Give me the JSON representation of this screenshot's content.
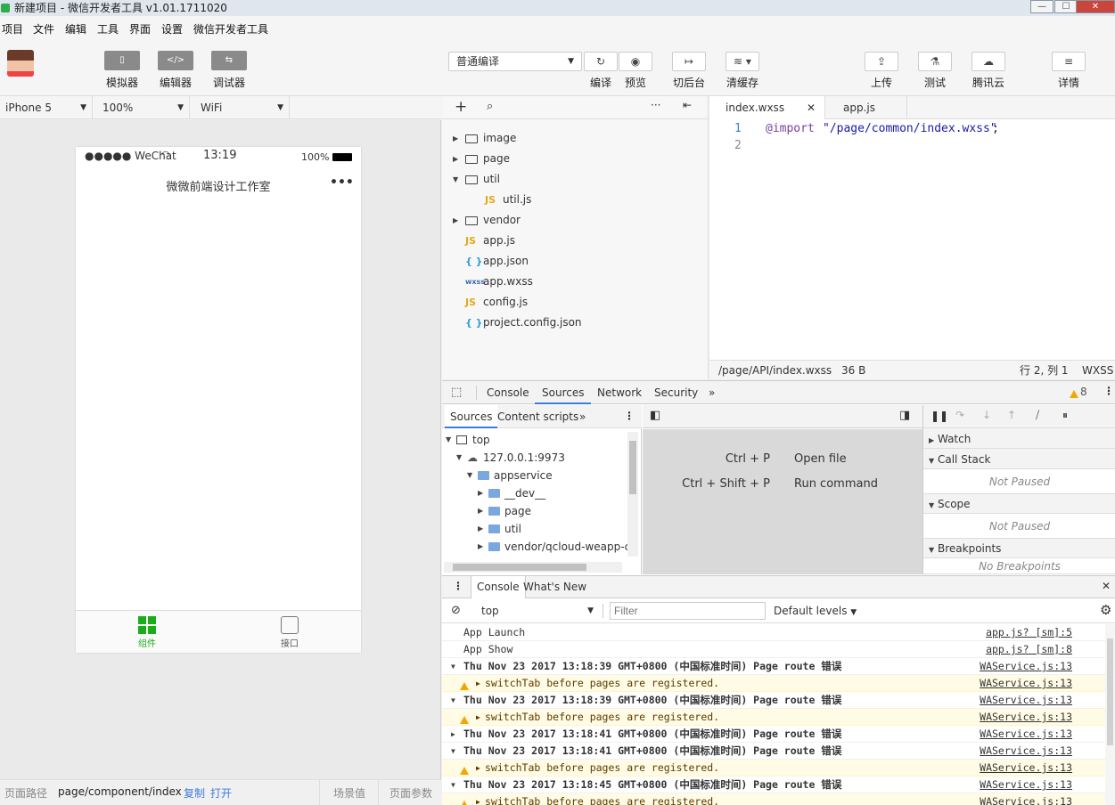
{
  "window": {
    "title": "新建项目 - 微信开发者工具 v1.01.1711020",
    "min": "—",
    "max": "☐",
    "close": "✕"
  },
  "menu": [
    "项目",
    "文件",
    "编辑",
    "工具",
    "界面",
    "设置",
    "微信开发者工具"
  ],
  "toolbar": {
    "left": [
      {
        "label": "模拟器",
        "icon": "phone-icon",
        "glyph": "▯"
      },
      {
        "label": "编辑器",
        "icon": "code-icon",
        "glyph": "</>"
      },
      {
        "label": "调试器",
        "icon": "debug-icon",
        "glyph": "⇆"
      }
    ],
    "compile_mode": "普通编译",
    "mid": [
      {
        "label": "编译",
        "icon": "refresh-icon",
        "glyph": "↻"
      },
      {
        "label": "预览",
        "icon": "eye-icon",
        "glyph": "◉"
      },
      {
        "label": "切后台",
        "icon": "switch-bg-icon",
        "glyph": "↦"
      },
      {
        "label": "清缓存",
        "icon": "layers-icon",
        "glyph": "≋"
      }
    ],
    "right": [
      {
        "label": "上传",
        "icon": "upload-icon",
        "glyph": "⇪"
      },
      {
        "label": "测试",
        "icon": "flask-icon",
        "glyph": "⚗"
      },
      {
        "label": "腾讯云",
        "icon": "cloud-icon",
        "glyph": "☁"
      },
      {
        "label": "详情",
        "icon": "menu-icon",
        "glyph": "≡"
      }
    ]
  },
  "simulator": {
    "device": "iPhone 5",
    "zoom": "100%",
    "network": "WiFi",
    "status_left": "●●●●● WeChat",
    "time": "13:19",
    "battery": "100%",
    "nav_title": "微微前端设计工作室",
    "nav_more": "•••",
    "tabs": [
      {
        "label": "组件",
        "icon": "grid-icon",
        "active": true
      },
      {
        "label": "接口",
        "icon": "api-icon",
        "active": false
      }
    ]
  },
  "bottombar": {
    "path_label": "页面路径",
    "path": "page/component/index",
    "copy": "复制",
    "open": "打开",
    "scene": "场景值",
    "params": "页面参数"
  },
  "filetree": {
    "items": [
      {
        "name": "image",
        "type": "folder",
        "expanded": false,
        "depth": 0
      },
      {
        "name": "page",
        "type": "folder",
        "expanded": false,
        "depth": 0
      },
      {
        "name": "util",
        "type": "folder",
        "expanded": true,
        "depth": 0
      },
      {
        "name": "util.js",
        "type": "js",
        "depth": 1
      },
      {
        "name": "vendor",
        "type": "folder",
        "expanded": false,
        "depth": 0
      },
      {
        "name": "app.js",
        "type": "js",
        "depth": 0
      },
      {
        "name": "app.json",
        "type": "json",
        "depth": 0
      },
      {
        "name": "app.wxss",
        "type": "wxss",
        "depth": 0
      },
      {
        "name": "config.js",
        "type": "js",
        "depth": 0
      },
      {
        "name": "project.config.json",
        "type": "json",
        "depth": 0
      }
    ],
    "badges": {
      "js": "JS",
      "json": "{ }",
      "wxss": "wxss"
    }
  },
  "editor": {
    "tabs": [
      {
        "label": "index.wxss",
        "active": true
      },
      {
        "label": "app.js",
        "active": false
      }
    ],
    "lines": [
      {
        "n": "1",
        "kw": "@import",
        "str": "\"/page/common/index.wxss\"",
        "end": ";"
      },
      {
        "n": "2",
        "kw": "",
        "str": "",
        "end": ""
      }
    ],
    "status_path": "/page/API/index.wxss",
    "status_size": "36 B",
    "status_pos": "行 2, 列 1",
    "status_lang": "WXSS"
  },
  "devtools": {
    "tabs": [
      "Console",
      "Sources",
      "Network",
      "Security"
    ],
    "active_tab": "Sources",
    "more": "»",
    "warn_count": "8",
    "src_tabs": [
      "Sources",
      "Content scripts"
    ],
    "src_tree": [
      {
        "label": "top",
        "depth": 0,
        "kind": "frame"
      },
      {
        "label": "127.0.0.1:9973",
        "depth": 1,
        "kind": "cloud"
      },
      {
        "label": "appservice",
        "depth": 2,
        "kind": "folder"
      },
      {
        "label": "__dev__",
        "depth": 3,
        "kind": "folder"
      },
      {
        "label": "page",
        "depth": 3,
        "kind": "folder"
      },
      {
        "label": "util",
        "depth": 3,
        "kind": "folder"
      },
      {
        "label": "vendor/qcloud-weapp-cli",
        "depth": 3,
        "kind": "folder"
      }
    ],
    "shortcuts": [
      {
        "keys": "Ctrl + P",
        "action": "Open file"
      },
      {
        "keys": "Ctrl + Shift + P",
        "action": "Run command"
      }
    ],
    "panes": [
      {
        "title": "Watch",
        "body": ""
      },
      {
        "title": "Call Stack",
        "body": "Not Paused"
      },
      {
        "title": "Scope",
        "body": "Not Paused"
      },
      {
        "title": "Breakpoints",
        "body": "No Breakpoints"
      }
    ],
    "console_tabs": [
      "Console",
      "What's New"
    ],
    "context": "top",
    "filter_placeholder": "Filter",
    "levels": "Default levels",
    "console": [
      {
        "type": "log",
        "text": "App Launch",
        "src": "app.js? [sm]:5"
      },
      {
        "type": "log",
        "text": "App Show",
        "src": "app.js? [sm]:8"
      },
      {
        "type": "group",
        "text": "Thu Nov 23 2017 13:18:39 GMT+0800 (中国标准时间) Page route 错误",
        "src": "WAService.js:13"
      },
      {
        "type": "warn",
        "text": "switchTab before pages are registered.",
        "src": "WAService.js:13"
      },
      {
        "type": "group",
        "text": "Thu Nov 23 2017 13:18:39 GMT+0800 (中国标准时间) Page route 错误",
        "src": "WAService.js:13"
      },
      {
        "type": "warn",
        "text": "switchTab before pages are registered.",
        "src": "WAService.js:13"
      },
      {
        "type": "group-closed",
        "text": "Thu Nov 23 2017 13:18:41 GMT+0800 (中国标准时间) Page route 错误",
        "src": "WAService.js:13"
      },
      {
        "type": "group",
        "text": "Thu Nov 23 2017 13:18:41 GMT+0800 (中国标准时间) Page route 错误",
        "src": "WAService.js:13"
      },
      {
        "type": "warn",
        "text": "switchTab before pages are registered.",
        "src": "WAService.js:13"
      },
      {
        "type": "group",
        "text": "Thu Nov 23 2017 13:18:45 GMT+0800 (中国标准时间) Page route 错误",
        "src": "WAService.js:13"
      },
      {
        "type": "warn",
        "text": "switchTab before pages are registered.",
        "src": "WAService.js:13"
      }
    ]
  },
  "colors": {
    "accent": "#3b7ddd",
    "green": "#1aad19",
    "warn": "#f2a600"
  }
}
